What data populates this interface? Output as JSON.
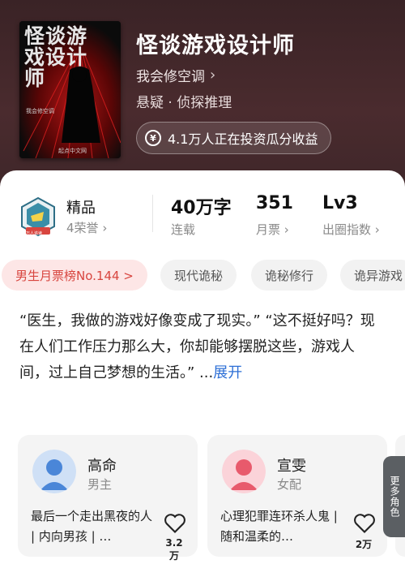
{
  "book": {
    "cover_title": "怪谈游戏设计师",
    "cover_author": "我会修空调",
    "cover_publisher": "起点中文网",
    "title": "怪谈游戏设计师",
    "author": "我会修空调",
    "genre": "悬疑 · 侦探推理",
    "invest_text": "4.1万人正在投资瓜分收益"
  },
  "stats": {
    "quality_label": "精品",
    "honor_label": "4荣誉",
    "badge_text": "万人追读",
    "words_value": "40万字",
    "words_label": "连载",
    "monthly_value": "351",
    "monthly_label": "月票",
    "level_value": "Lv3",
    "level_label": "出圈指数"
  },
  "tags": [
    "男生月票榜No.144 >",
    "现代诡秘",
    "诡秘修行",
    "诡异游戏"
  ],
  "intro": {
    "text": "“医生，我做的游戏好像变成了现实。” “这不挺好吗？现在人们工作压力那么大，你却能够摆脱这些，游戏人间，过上自己梦想的生活。” ...",
    "expand": "展开"
  },
  "characters": [
    {
      "name": "高命",
      "role": "男主",
      "desc": "最后一个走出黑夜的人 | 内向男孩 | …",
      "likes": "3.2万",
      "color": "#4a86d8"
    },
    {
      "name": "宣雯",
      "role": "女配",
      "desc": "心理犯罪连环杀人鬼 | 随和温柔的…",
      "likes": "2万",
      "color": "#e85a6c"
    }
  ],
  "more_roles": "更多角色",
  "colors": {
    "accent_red": "#d8453f",
    "link_blue": "#2d6fd6",
    "header_bg": "#4a2b2e"
  }
}
